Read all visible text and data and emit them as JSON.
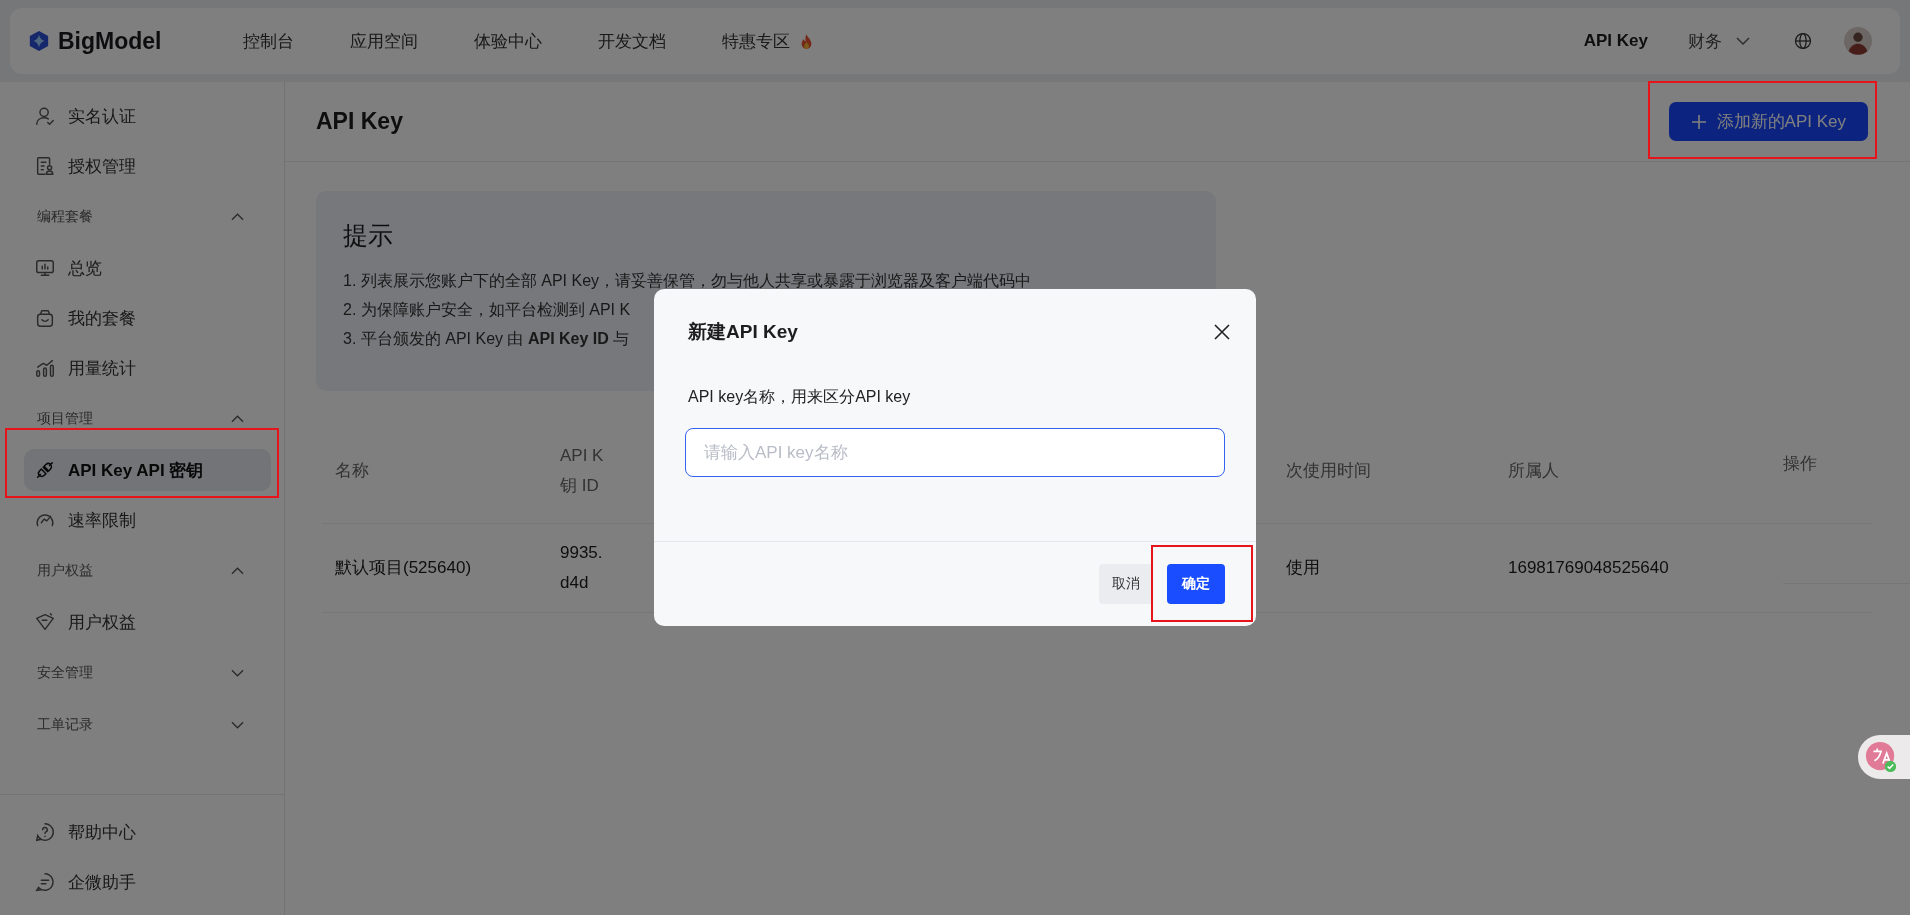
{
  "topbar": {
    "logo": "BigModel",
    "nav": [
      {
        "label": "控制台",
        "kind": "plain"
      },
      {
        "label": "应用空间",
        "kind": "plain"
      },
      {
        "label": "体验中心",
        "kind": "plain"
      },
      {
        "label": "开发文档",
        "kind": "plain"
      },
      {
        "label": "特惠专区",
        "kind": "hot"
      }
    ],
    "api_key_link": "API Key",
    "finance_menu": "财务"
  },
  "sidebar": {
    "items": [
      {
        "kind": "item",
        "label": "实名认证",
        "selected": false
      },
      {
        "kind": "item",
        "label": "授权管理",
        "selected": false
      },
      {
        "kind": "group",
        "label": "编程套餐",
        "expanded": true,
        "children": [
          {
            "kind": "item",
            "label": "总览",
            "selected": false
          },
          {
            "kind": "item",
            "label": "我的套餐",
            "selected": false
          },
          {
            "kind": "item",
            "label": "用量统计",
            "selected": false
          }
        ]
      },
      {
        "kind": "group",
        "label": "项目管理",
        "expanded": true,
        "children": [
          {
            "kind": "item",
            "label": "API Key  API 密钥",
            "selected": true
          },
          {
            "kind": "item",
            "label": "速率限制",
            "selected": false
          }
        ]
      },
      {
        "kind": "group",
        "label": "用户权益",
        "expanded": true,
        "children": [
          {
            "kind": "item",
            "label": "用户权益",
            "selected": false
          }
        ]
      },
      {
        "kind": "group",
        "label": "安全管理",
        "expanded": false
      },
      {
        "kind": "group",
        "label": "工单记录",
        "expanded": false
      }
    ],
    "footer": [
      "帮助中心",
      "企微助手"
    ]
  },
  "page": {
    "title": "API Key",
    "add_button": "添加新的API Key"
  },
  "tip": {
    "title": "提示",
    "lines": [
      "1. 列表展示您账户下的全部 API Key，请妥善保管，勿与他人共享或暴露于浏览器及客户端代码中",
      "2. 为保障账户安全，如平台检测到 API K",
      "3. 平台颁发的 API Key 由 **API Key ID** 与"
    ]
  },
  "table": {
    "columns": [
      "名称",
      "API K\n钥 ID",
      "次使用时间",
      "所属人",
      "操作"
    ],
    "rows": [
      [
        "默认项目(525640)",
        "9935.\nd4d",
        "使用",
        "16981769048525640"
      ]
    ]
  },
  "dialog": {
    "title": "新建API Key",
    "label": "API key名称，用来区分API key",
    "placeholder": "请输入API key名称",
    "buttons": [
      {
        "label": "取消",
        "kind": "secondary"
      },
      {
        "label": "确定",
        "kind": "primary"
      }
    ]
  }
}
